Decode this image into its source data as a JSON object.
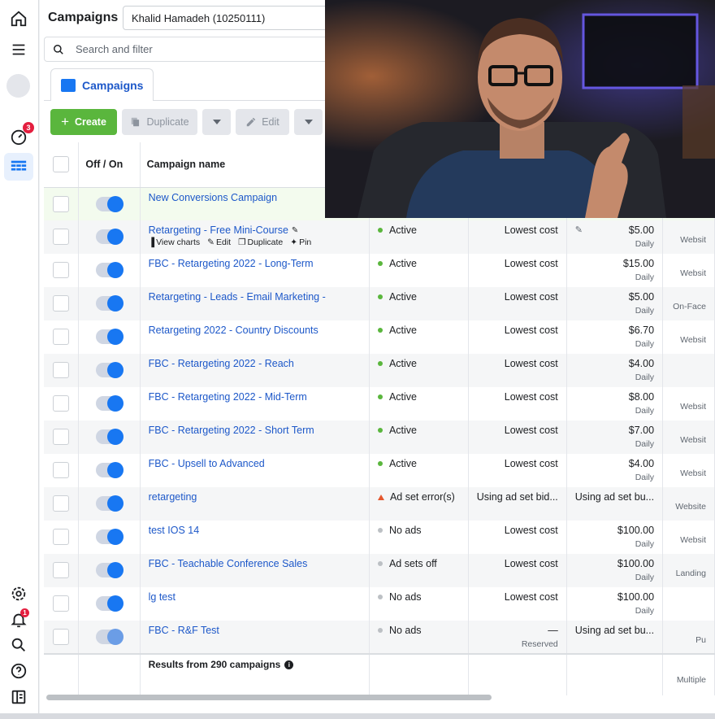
{
  "header": {
    "title": "Campaigns",
    "account": "Khalid Hamadeh (10250111)",
    "search_placeholder": "Search and filter"
  },
  "tabs": {
    "campaigns_label": "Campaigns"
  },
  "toolbar": {
    "create_label": "Create",
    "duplicate_label": "Duplicate",
    "edit_label": "Edit"
  },
  "rail": {
    "speedometer_badge": "3",
    "notifications_badge": "1"
  },
  "columns": {
    "toggle": "Off / On",
    "name": "Campaign name"
  },
  "row_actions": {
    "view_charts": "View charts",
    "edit": "Edit",
    "duplicate": "Duplicate",
    "pin": "Pin"
  },
  "rows": [
    {
      "name": "New Conversions Campaign",
      "delivery": "",
      "bid": "",
      "budget": "",
      "budget_sub": "",
      "attribution": "",
      "status_color": "none"
    },
    {
      "name": "Retargeting - Free Mini-Course",
      "delivery": "Active",
      "bid": "Lowest cost",
      "budget": "$5.00",
      "budget_sub": "Daily",
      "attribution": "Websit",
      "status_color": "#5ab63d"
    },
    {
      "name": "FBC - Retargeting 2022 - Long-Term",
      "delivery": "Active",
      "bid": "Lowest cost",
      "budget": "$15.00",
      "budget_sub": "Daily",
      "attribution": "Websit",
      "status_color": "#5ab63d"
    },
    {
      "name": "Retargeting - Leads - Email Marketing -",
      "delivery": "Active",
      "bid": "Lowest cost",
      "budget": "$5.00",
      "budget_sub": "Daily",
      "attribution": "On-Face",
      "status_color": "#5ab63d"
    },
    {
      "name": "Retargeting 2022 - Country Discounts",
      "delivery": "Active",
      "bid": "Lowest cost",
      "budget": "$6.70",
      "budget_sub": "Daily",
      "attribution": "Websit",
      "status_color": "#5ab63d"
    },
    {
      "name": "FBC - Retargeting 2022 - Reach",
      "delivery": "Active",
      "bid": "Lowest cost",
      "budget": "$4.00",
      "budget_sub": "Daily",
      "attribution": "",
      "status_color": "#5ab63d"
    },
    {
      "name": "FBC - Retargeting 2022 - Mid-Term",
      "delivery": "Active",
      "bid": "Lowest cost",
      "budget": "$8.00",
      "budget_sub": "Daily",
      "attribution": "Websit",
      "status_color": "#5ab63d"
    },
    {
      "name": "FBC - Retargeting 2022 - Short Term",
      "delivery": "Active",
      "bid": "Lowest cost",
      "budget": "$7.00",
      "budget_sub": "Daily",
      "attribution": "Websit",
      "status_color": "#5ab63d"
    },
    {
      "name": "FBC - Upsell to Advanced",
      "delivery": "Active",
      "bid": "Lowest cost",
      "budget": "$4.00",
      "budget_sub": "Daily",
      "attribution": "Websit",
      "status_color": "#5ab63d"
    },
    {
      "name": "retargeting",
      "delivery": "Ad set error(s)",
      "bid": "Using ad set bid...",
      "budget": "Using ad set bu...",
      "budget_sub": "",
      "attribution": "Website",
      "status_color": "error"
    },
    {
      "name": "test IOS 14",
      "delivery": "No ads",
      "bid": "Lowest cost",
      "budget": "$100.00",
      "budget_sub": "Daily",
      "attribution": "Websit",
      "status_color": "#bcc0c4"
    },
    {
      "name": "FBC - Teachable Conference Sales",
      "delivery": "Ad sets off",
      "bid": "Lowest cost",
      "budget": "$100.00",
      "budget_sub": "Daily",
      "attribution": "Landing",
      "status_color": "#bcc0c4"
    },
    {
      "name": "lg test",
      "delivery": "No ads",
      "bid": "Lowest cost",
      "budget": "$100.00",
      "budget_sub": "Daily",
      "attribution": "",
      "status_color": "#bcc0c4"
    },
    {
      "name": "FBC - R&F Test",
      "delivery": "No ads",
      "bid": "—",
      "bid_sub": "Reserved",
      "budget": "Using ad set bu...",
      "budget_sub": "",
      "attribution": "Pu",
      "status_color": "#bcc0c4"
    }
  ],
  "results": {
    "label": "Results from 290 campaigns",
    "attribution": "Multiple"
  }
}
